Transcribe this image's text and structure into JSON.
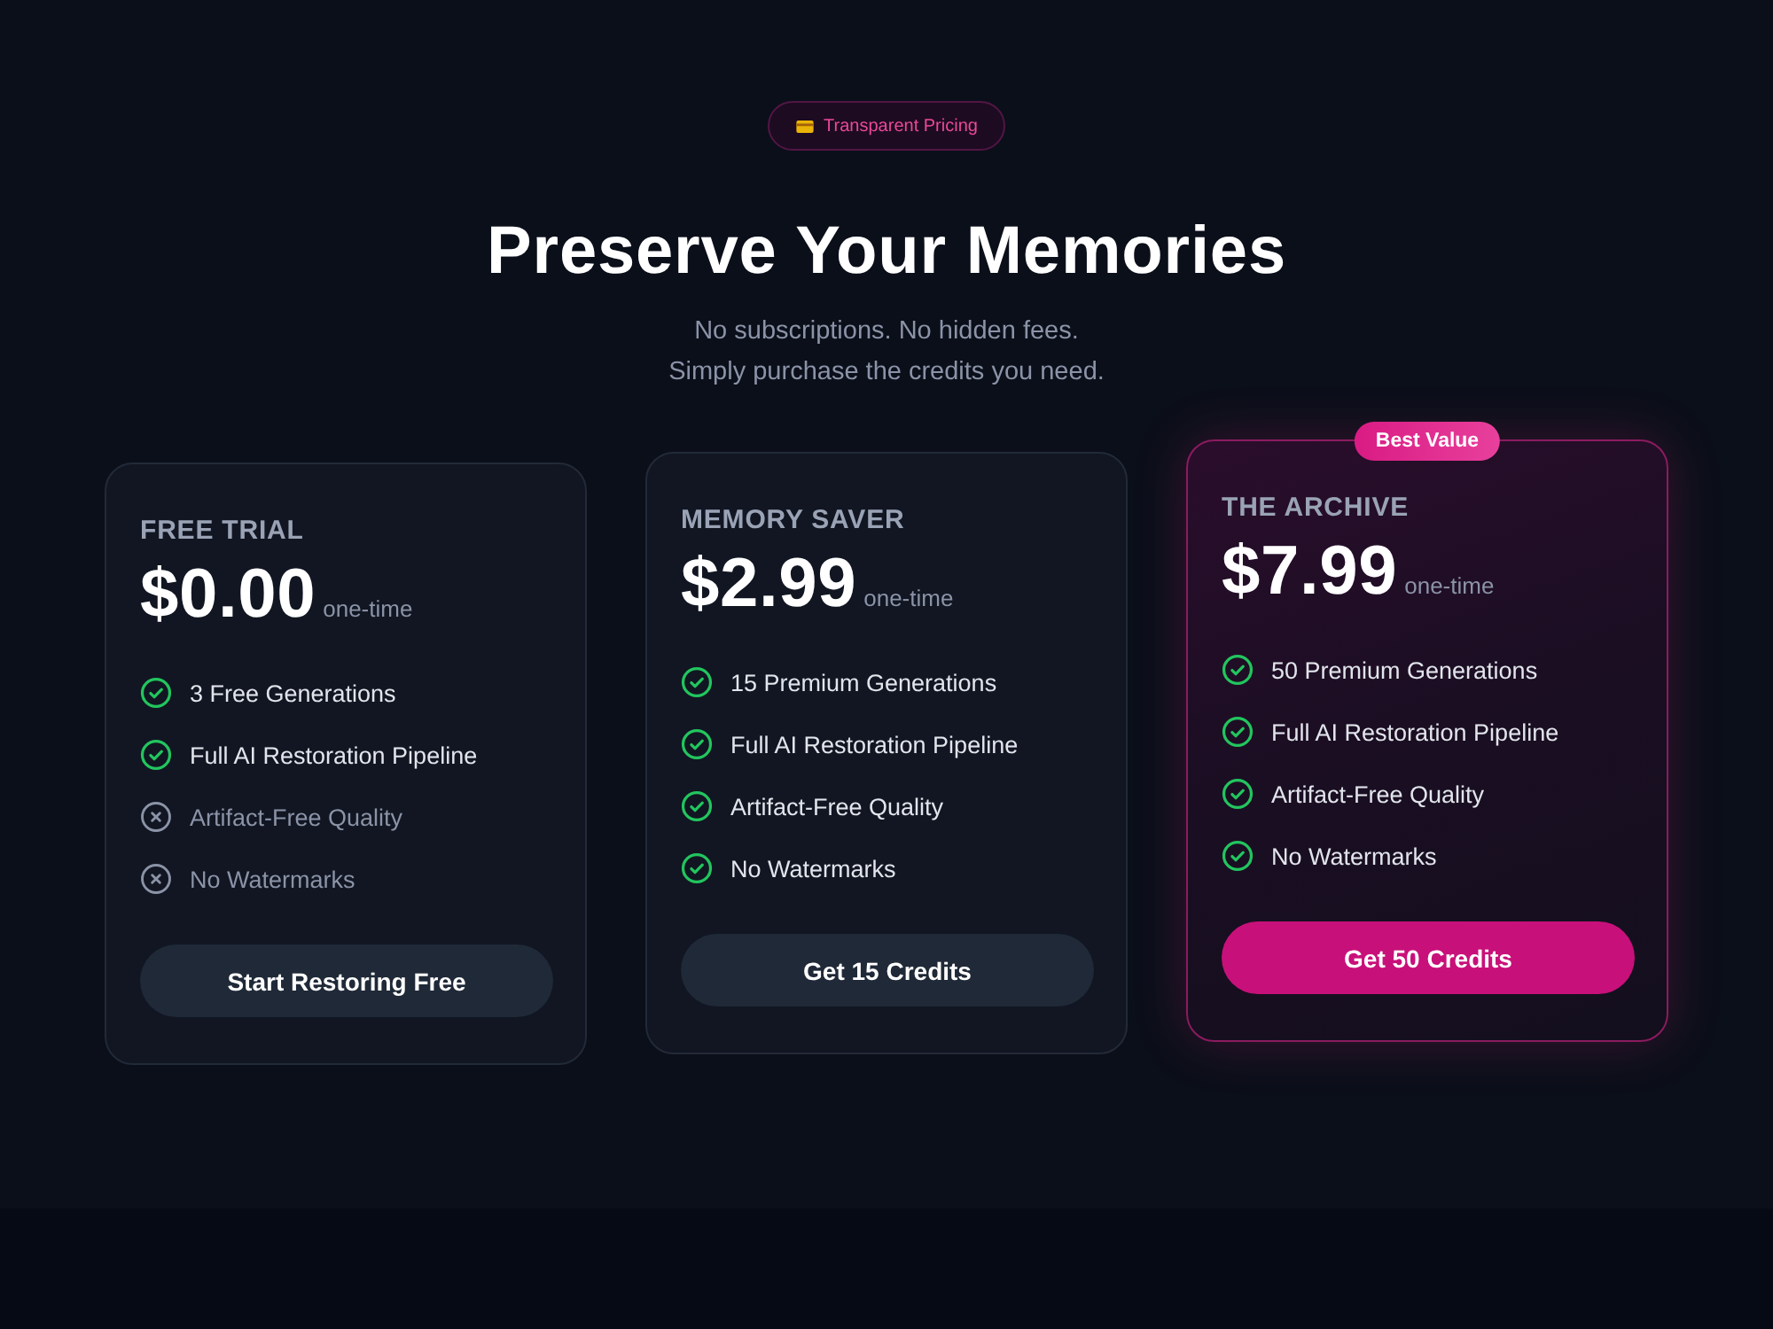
{
  "badge": {
    "label": "Transparent Pricing"
  },
  "heading": "Preserve Your Memories",
  "subtitle_lines": [
    "No subscriptions. No hidden fees.",
    "Simply purchase the credits you need."
  ],
  "plans": [
    {
      "name": "FREE TRIAL",
      "price": "$0.00",
      "period": "one-time",
      "featured": false,
      "features": [
        {
          "label": "3 Free Generations",
          "included": true
        },
        {
          "label": "Full AI Restoration Pipeline",
          "included": true
        },
        {
          "label": "Artifact-Free Quality",
          "included": false
        },
        {
          "label": "No Watermarks",
          "included": false
        }
      ],
      "button": "Start Restoring Free"
    },
    {
      "name": "MEMORY SAVER",
      "price": "$2.99",
      "period": "one-time",
      "featured": false,
      "features": [
        {
          "label": "15 Premium Generations",
          "included": true
        },
        {
          "label": "Full AI Restoration Pipeline",
          "included": true
        },
        {
          "label": "Artifact-Free Quality",
          "included": true
        },
        {
          "label": "No Watermarks",
          "included": true
        }
      ],
      "button": "Get 15 Credits"
    },
    {
      "name": "THE ARCHIVE",
      "price": "$7.99",
      "period": "one-time",
      "featured": true,
      "ribbon": "Best Value",
      "features": [
        {
          "label": "50 Premium Generations",
          "included": true
        },
        {
          "label": "Full AI Restoration Pipeline",
          "included": true
        },
        {
          "label": "Artifact-Free Quality",
          "included": true
        },
        {
          "label": "No Watermarks",
          "included": true
        }
      ],
      "button": "Get 50 Credits"
    }
  ]
}
